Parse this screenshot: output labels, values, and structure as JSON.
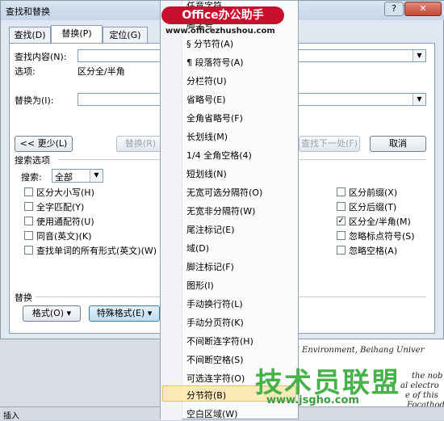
{
  "dialog": {
    "title": "查找和替换",
    "help": "?",
    "close": "✕",
    "tabs": [
      "查找(D)",
      "替换(P)",
      "定位(G)"
    ]
  },
  "find": {
    "label": "查找内容(N):",
    "value": "",
    "options_label": "选项:",
    "options_value": "区分全/半角"
  },
  "replace": {
    "label": "替换为(I):",
    "value": ""
  },
  "buttons": {
    "less": "<< 更少(L)",
    "replace": "替换(R)",
    "find_next": "查找下一处(F)",
    "cancel": "取消",
    "format": "格式(O) ▾",
    "special": "特殊格式(E) ▾"
  },
  "search_options": {
    "heading": "搜索选项",
    "search_label": "搜索:",
    "search_value": "全部",
    "left": [
      {
        "label": "区分大小写(H)",
        "checked": false
      },
      {
        "label": "全字匹配(Y)",
        "checked": false
      },
      {
        "label": "使用通配符(U)",
        "checked": false
      },
      {
        "label": "同音(英文)(K)",
        "checked": false
      },
      {
        "label": "查找单词的所有形式(英文)(W)",
        "checked": false
      }
    ],
    "right": [
      {
        "label": "区分前缀(X)",
        "checked": false
      },
      {
        "label": "区分后缀(T)",
        "checked": false
      },
      {
        "label": "区分全/半角(M)",
        "checked": true
      },
      {
        "label": "忽略标点符号(S)",
        "checked": false
      },
      {
        "label": "忽略空格(A)",
        "checked": false
      }
    ]
  },
  "replace_section": {
    "heading": "替换"
  },
  "menu": {
    "items": [
      "任意字符",
      "脚字号",
      "§ 分节符(A)",
      "¶ 段落符号(A)",
      "分栏符(U)",
      "省略号(E)",
      "全角省略号(F)",
      "长划线(M)",
      "1/4 全角空格(4)",
      "短划线(N)",
      "无宽可选分隔符(O)",
      "无宽非分隔符(W)",
      "尾注标记(E)",
      "域(D)",
      "脚注标记(F)",
      "图形(I)",
      "手动换行符(L)",
      "手动分页符(K)",
      "不间断连字符(H)",
      "不间断空格(S)",
      "可选连字符(O)",
      "分节符(B)",
      "空白区域(W)"
    ],
    "highlighted_index": 21
  },
  "document": {
    "lines": [
      "nd Environment, Beihang Univer",
      "the nob",
      "al electro",
      "e of  this",
      "Focathod"
    ]
  },
  "statusbar": {
    "text": "插入"
  },
  "watermarks": {
    "office_logo": "Office办公助手",
    "office_url": "www.officezhushou.com",
    "jsgho_logo": "技术员联盟",
    "jsgho_url": "www.jsgho.com"
  },
  "colors": {
    "menu_highlight": "#fbe9b7",
    "office_red": "#c8102e",
    "jsgho_green": "#47b24a"
  }
}
